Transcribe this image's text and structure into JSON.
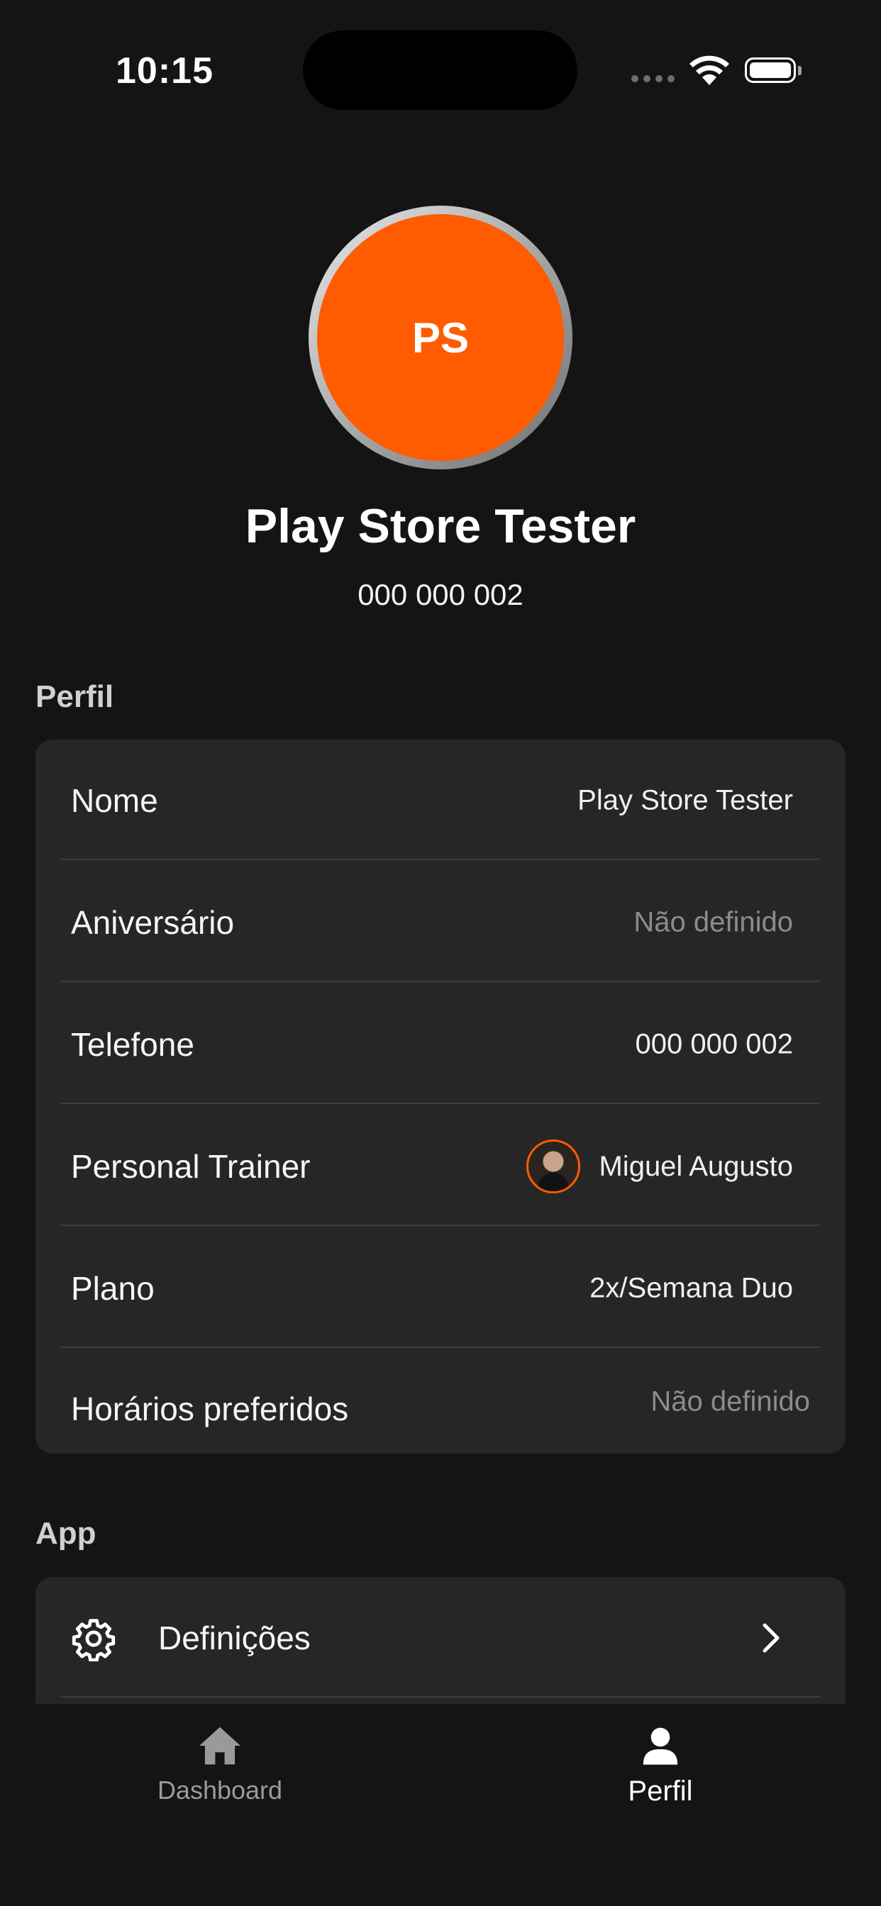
{
  "status_bar": {
    "time": "10:15"
  },
  "profile_header": {
    "initials": "PS",
    "avatar_color": "#ff5b00",
    "name": "Play Store Tester",
    "phone": "000 000 002"
  },
  "sections": {
    "perfil": {
      "title": "Perfil",
      "rows": [
        {
          "label": "Nome",
          "value": "Play Store Tester"
        },
        {
          "label": "Aniversário",
          "value": "Não definido"
        },
        {
          "label": "Telefone",
          "value": "000 000 002"
        },
        {
          "label": "Personal Trainer",
          "value": "Miguel Augusto"
        },
        {
          "label": "Plano",
          "value": "2x/Semana Duo"
        },
        {
          "label": "Horários preferidos",
          "value": "Não definido"
        }
      ]
    },
    "app": {
      "title": "App",
      "rows": [
        {
          "label": "Definições",
          "icon": "gear-icon"
        }
      ]
    }
  },
  "tab_bar": {
    "tabs": [
      {
        "label": "Dashboard",
        "icon": "home-icon",
        "active": false
      },
      {
        "label": "Perfil",
        "icon": "person-icon",
        "active": true
      }
    ]
  },
  "colors": {
    "accent": "#ff5b00",
    "background": "#141414",
    "card": "#262626"
  }
}
